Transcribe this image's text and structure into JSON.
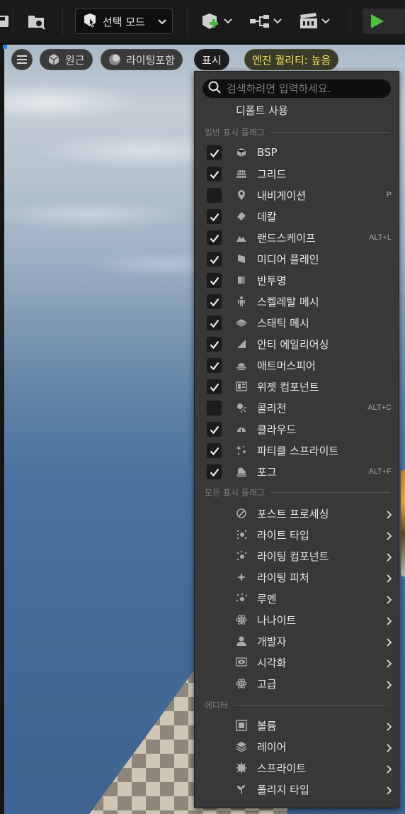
{
  "toolbar": {
    "mode_label": "선택 모드"
  },
  "viewport": {
    "perspective_label": "원근",
    "lighting_label": "라이팅포함",
    "show_label": "표시",
    "quality_label": "엔진 퀄리티: 높음"
  },
  "menu": {
    "search_placeholder": "검색하려면 입력하세요.",
    "default_label": "디폴트 사용",
    "section_common": "일반 표시 플래그",
    "section_all": "모든 표시 플래그",
    "section_editor": "에디터",
    "common_flags": [
      {
        "label": "BSP",
        "checked": true,
        "shortcut": "",
        "icon": "bsp-icon"
      },
      {
        "label": "그리드",
        "checked": true,
        "shortcut": "",
        "icon": "grid-icon"
      },
      {
        "label": "내비게이션",
        "checked": false,
        "shortcut": "P",
        "icon": "navigation-pin-icon"
      },
      {
        "label": "데칼",
        "checked": true,
        "shortcut": "",
        "icon": "decal-icon"
      },
      {
        "label": "랜드스케이프",
        "checked": true,
        "shortcut": "ALT+L",
        "icon": "landscape-icon"
      },
      {
        "label": "미디어 플레인",
        "checked": true,
        "shortcut": "",
        "icon": "media-plane-icon"
      },
      {
        "label": "반투명",
        "checked": true,
        "shortcut": "",
        "icon": "translucency-icon"
      },
      {
        "label": "스켈레탈 메시",
        "checked": true,
        "shortcut": "",
        "icon": "skeletal-mesh-icon"
      },
      {
        "label": "스태틱 메시",
        "checked": true,
        "shortcut": "",
        "icon": "static-mesh-icon"
      },
      {
        "label": "안티 에일리어싱",
        "checked": true,
        "shortcut": "",
        "icon": "anti-aliasing-icon"
      },
      {
        "label": "애트머스피어",
        "checked": true,
        "shortcut": "",
        "icon": "atmosphere-icon"
      },
      {
        "label": "위젯 컴포넌트",
        "checked": true,
        "shortcut": "",
        "icon": "widget-component-icon"
      },
      {
        "label": "콜리전",
        "checked": false,
        "shortcut": "ALT+C",
        "icon": "collision-icon"
      },
      {
        "label": "클라우드",
        "checked": true,
        "shortcut": "",
        "icon": "cloud-icon"
      },
      {
        "label": "파티클 스프라이트",
        "checked": true,
        "shortcut": "",
        "icon": "particle-sprite-icon"
      },
      {
        "label": "포그",
        "checked": true,
        "shortcut": "ALT+F",
        "icon": "fog-icon"
      }
    ],
    "all_flags": [
      {
        "label": "포스트 프로세싱",
        "icon": "post-processing-icon"
      },
      {
        "label": "라이트 타입",
        "icon": "light-type-icon"
      },
      {
        "label": "라이팅 컴포넌트",
        "icon": "lighting-component-icon"
      },
      {
        "label": "라이팅 피처",
        "icon": "lighting-feature-icon"
      },
      {
        "label": "루멘",
        "icon": "lumen-icon"
      },
      {
        "label": "나나이트",
        "icon": "nanite-icon"
      },
      {
        "label": "개발자",
        "icon": "developer-icon"
      },
      {
        "label": "시각화",
        "icon": "visualize-icon"
      },
      {
        "label": "고급",
        "icon": "advanced-icon"
      }
    ],
    "editor_flags": [
      {
        "label": "볼륨",
        "icon": "volume-icon"
      },
      {
        "label": "레이어",
        "icon": "layer-icon"
      },
      {
        "label": "스프라이트",
        "icon": "sprite-icon"
      },
      {
        "label": "폴리지 타입",
        "icon": "foliage-type-icon"
      }
    ]
  }
}
